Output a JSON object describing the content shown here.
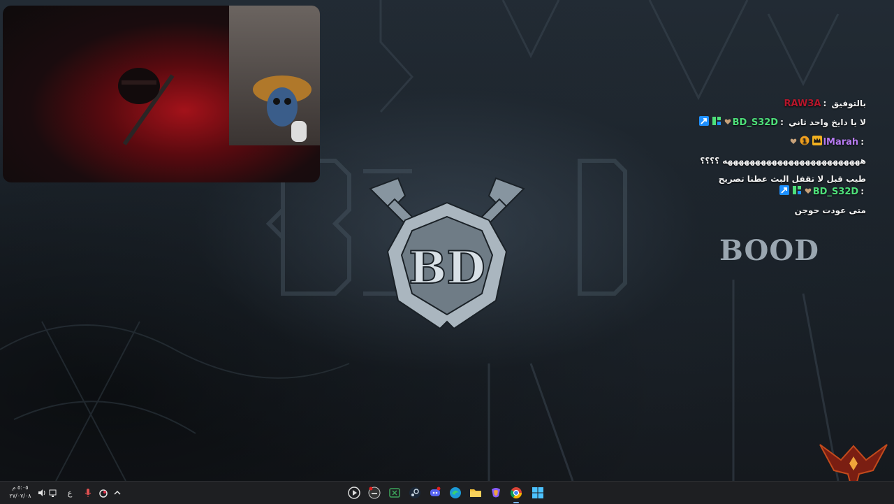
{
  "chat": {
    "messages": [
      {
        "user": "RAW3A",
        "user_color": "#b5162b",
        "separator": ":",
        "text": "بالتوفيق",
        "badges": []
      },
      {
        "user": "BD_S32D",
        "user_color": "#4ee07a",
        "separator": ":",
        "text": "لا يا دايخ واحد ثاني",
        "badges": [
          "moderator-icon",
          "prime-icon",
          "heart-icon"
        ]
      },
      {
        "user": "lMarah",
        "user_color": "#b57af0",
        "separator": ":",
        "text": "",
        "badges": [
          "heart-icon",
          "months-1-icon",
          "crown-icon"
        ]
      },
      {
        "user": "",
        "user_color": "#ffffff",
        "separator": "",
        "text": "هههههههههههههههههههههههههه ؟؟؟؟",
        "badges": []
      },
      {
        "user": "BD_S32D",
        "user_color": "#4ee07a",
        "separator": ":",
        "text": "طيب قبل لا تقفل البث عطنا تصريح",
        "badges": [
          "moderator-icon",
          "prime-icon",
          "heart-icon"
        ]
      },
      {
        "user": "",
        "user_color": "#ffffff",
        "separator": "",
        "text": "متى عودت حوجن",
        "badges": []
      }
    ]
  },
  "overlay": {
    "brand_text": "BOOD",
    "center_logo_text": "BD"
  },
  "taskbar": {
    "clock_time": "٥:٠٥ م",
    "clock_date": "٢٧/٠٧/٠٨",
    "language": "ع",
    "apps": [
      {
        "name": "media-player-icon"
      },
      {
        "name": "game-controller-icon"
      },
      {
        "name": "xbox-icon"
      },
      {
        "name": "steam-icon"
      },
      {
        "name": "discord-icon"
      },
      {
        "name": "edge-icon"
      },
      {
        "name": "file-explorer-icon"
      },
      {
        "name": "copilot-icon"
      },
      {
        "name": "chrome-icon"
      },
      {
        "name": "windows-start-icon"
      }
    ]
  },
  "colors": {
    "moderator": "#1e90ff",
    "prime": "#4ee07a",
    "accent_red": "#b5162b"
  }
}
